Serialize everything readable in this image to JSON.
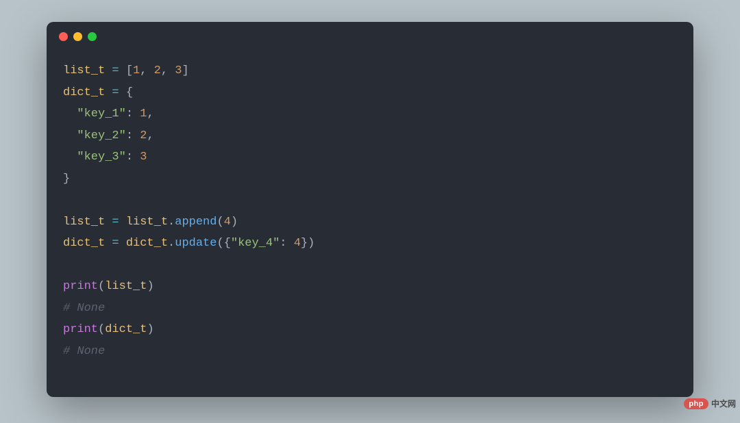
{
  "window": {
    "buttons": {
      "close": "#ff5f56",
      "minimize": "#ffbd2e",
      "zoom": "#27c93f"
    }
  },
  "code": {
    "line1": {
      "var": "list_t",
      "eq": "=",
      "lb": "[",
      "v1": "1",
      "c1": ",",
      "v2": "2",
      "c2": ",",
      "v3": "3",
      "rb": "]"
    },
    "line2": {
      "var": "dict_t",
      "eq": "=",
      "lb": "{"
    },
    "line3": {
      "key": "\"key_1\"",
      "colon": ":",
      "val": "1",
      "comma": ","
    },
    "line4": {
      "key": "\"key_2\"",
      "colon": ":",
      "val": "2",
      "comma": ","
    },
    "line5": {
      "key": "\"key_3\"",
      "colon": ":",
      "val": "3"
    },
    "line6": {
      "rb": "}"
    },
    "line8": {
      "var1": "list_t",
      "eq": "=",
      "var2": "list_t",
      "dot": ".",
      "fn": "append",
      "lp": "(",
      "arg": "4",
      "rp": ")"
    },
    "line9": {
      "var1": "dict_t",
      "eq": "=",
      "var2": "dict_t",
      "dot": ".",
      "fn": "update",
      "lp": "(",
      "lb": "{",
      "key": "\"key_4\"",
      "colon": ":",
      "val": "4",
      "rb": "}",
      "rp": ")"
    },
    "line11": {
      "fn": "print",
      "lp": "(",
      "arg": "list_t",
      "rp": ")"
    },
    "line12": {
      "comment": "# None"
    },
    "line13": {
      "fn": "print",
      "lp": "(",
      "arg": "dict_t",
      "rp": ")"
    },
    "line14": {
      "comment": "# None"
    }
  },
  "watermark": {
    "badge": "php",
    "text": "中文网"
  }
}
